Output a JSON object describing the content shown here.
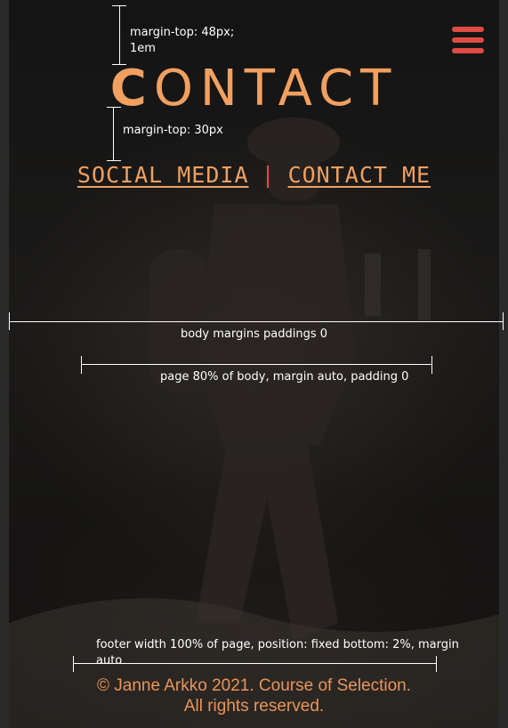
{
  "header": {
    "title": "CONTACT",
    "menu_icon": "hamburger-menu-icon"
  },
  "nav": {
    "items": [
      {
        "label": "SOCIAL MEDIA"
      },
      {
        "label": "CONTACT ME"
      }
    ],
    "separator": "|"
  },
  "annotations": {
    "margin_top_48": "margin-top: 48px;",
    "margin_top_48_b": "1em",
    "margin_top_30": "margin-top: 30px",
    "body_margins": "body margins paddings 0",
    "page_width": "page 80% of body, margin auto, padding 0",
    "footer_note_a": "footer width 100% of page, position: fixed bottom: 2%, margin",
    "footer_note_b": "auto"
  },
  "footer": {
    "line1": "© Janne Arkko 2021. Course of Selection.",
    "line2": "All rights reserved."
  },
  "colors": {
    "accent": "#f0a060",
    "menu": "#e04b45",
    "background": "#111111"
  }
}
